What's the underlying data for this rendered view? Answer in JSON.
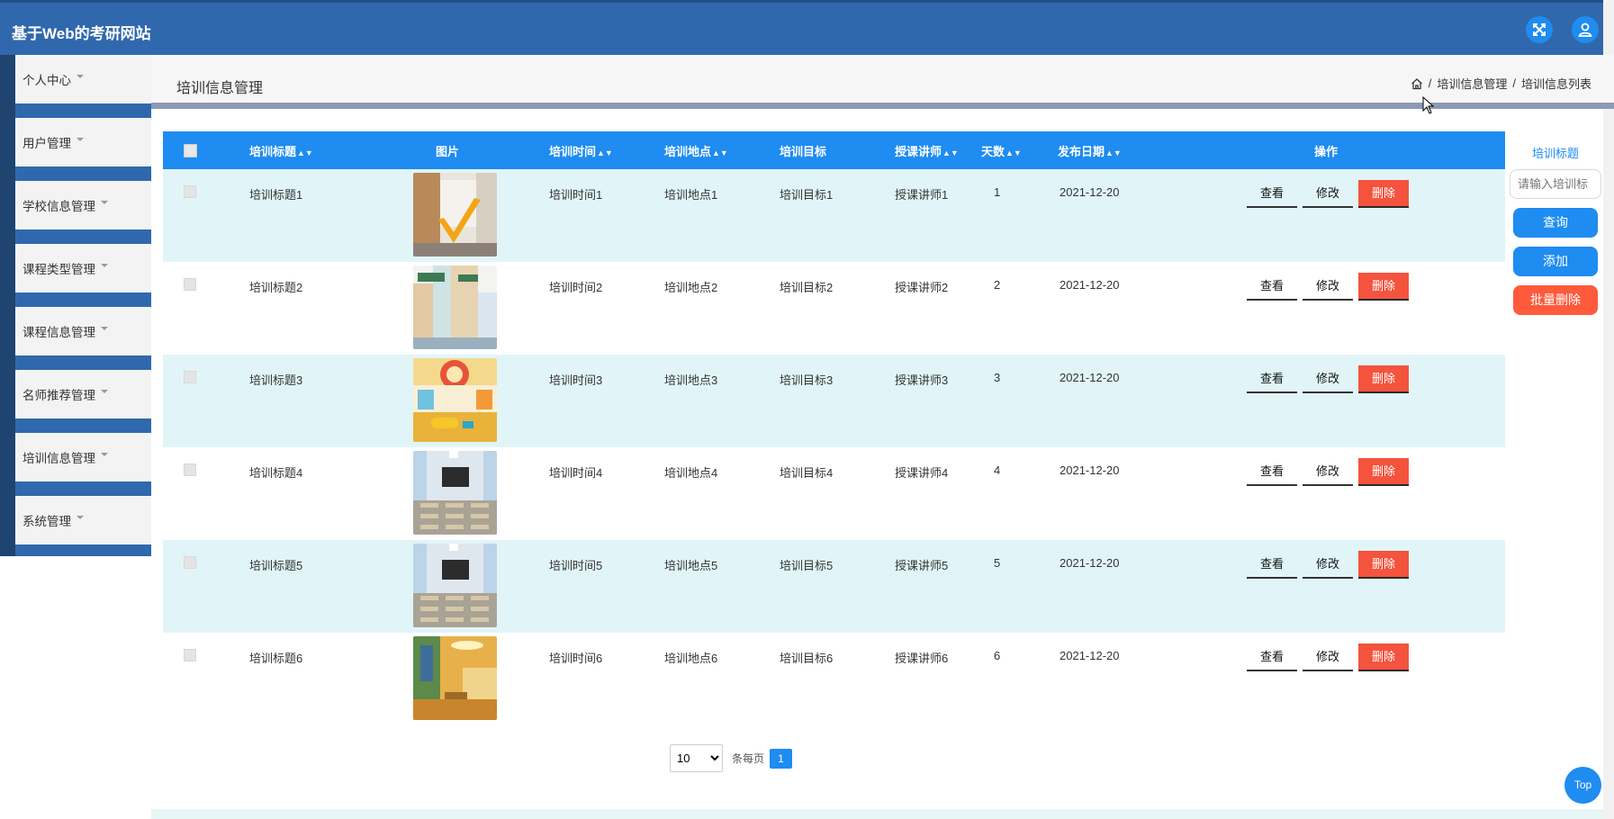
{
  "header": {
    "site_title": "基于Web的考研网站",
    "fullscreen_icon": "fullscreen-icon",
    "user_icon": "user-icon"
  },
  "sidebar": {
    "items": [
      {
        "label": "个人中心"
      },
      {
        "label": "用户管理"
      },
      {
        "label": "学校信息管理"
      },
      {
        "label": "课程类型管理"
      },
      {
        "label": "课程信息管理"
      },
      {
        "label": "名师推荐管理"
      },
      {
        "label": "培训信息管理"
      },
      {
        "label": "系统管理"
      }
    ]
  },
  "page": {
    "title": "培训信息管理",
    "breadcrumb": {
      "home_icon": "home-icon",
      "level1": "培训信息管理",
      "level2": "培训信息列表",
      "separator": "/"
    }
  },
  "table": {
    "columns": [
      "培训标题",
      "图片",
      "培训时间",
      "培训地点",
      "培训目标",
      "授课讲师",
      "天数",
      "发布日期",
      "操作"
    ],
    "sortable": [
      true,
      false,
      true,
      true,
      false,
      true,
      true,
      true,
      false
    ],
    "rows": [
      {
        "title": "培训标题1",
        "time": "培训时间1",
        "place": "培训地点1",
        "goal": "培训目标1",
        "teacher": "授课讲师1",
        "days": "1",
        "date": "2021-12-20"
      },
      {
        "title": "培训标题2",
        "time": "培训时间2",
        "place": "培训地点2",
        "goal": "培训目标2",
        "teacher": "授课讲师2",
        "days": "2",
        "date": "2021-12-20"
      },
      {
        "title": "培训标题3",
        "time": "培训时间3",
        "place": "培训地点3",
        "goal": "培训目标3",
        "teacher": "授课讲师3",
        "days": "3",
        "date": "2021-12-20"
      },
      {
        "title": "培训标题4",
        "time": "培训时间4",
        "place": "培训地点4",
        "goal": "培训目标4",
        "teacher": "授课讲师4",
        "days": "4",
        "date": "2021-12-20"
      },
      {
        "title": "培训标题5",
        "time": "培训时间5",
        "place": "培训地点5",
        "goal": "培训目标5",
        "teacher": "授课讲师5",
        "days": "5",
        "date": "2021-12-20"
      },
      {
        "title": "培训标题6",
        "time": "培训时间6",
        "place": "培训地点6",
        "goal": "培训目标6",
        "teacher": "授课讲师6",
        "days": "6",
        "date": "2021-12-20"
      }
    ],
    "actions": {
      "view": "查看",
      "edit": "修改",
      "delete": "删除"
    }
  },
  "search": {
    "label": "培训标题",
    "placeholder": "请输入培训标",
    "query_button": "查询",
    "add_button": "添加",
    "batch_delete_button": "批量删除"
  },
  "pagination": {
    "page_size": "10",
    "per_page_label": "条每页",
    "current_page": "1"
  },
  "back_to_top": "Top",
  "colors": {
    "header": "#3068ad",
    "primary": "#1e8cf0",
    "danger": "#f4533d",
    "row_alt": "#e1f5f8"
  }
}
